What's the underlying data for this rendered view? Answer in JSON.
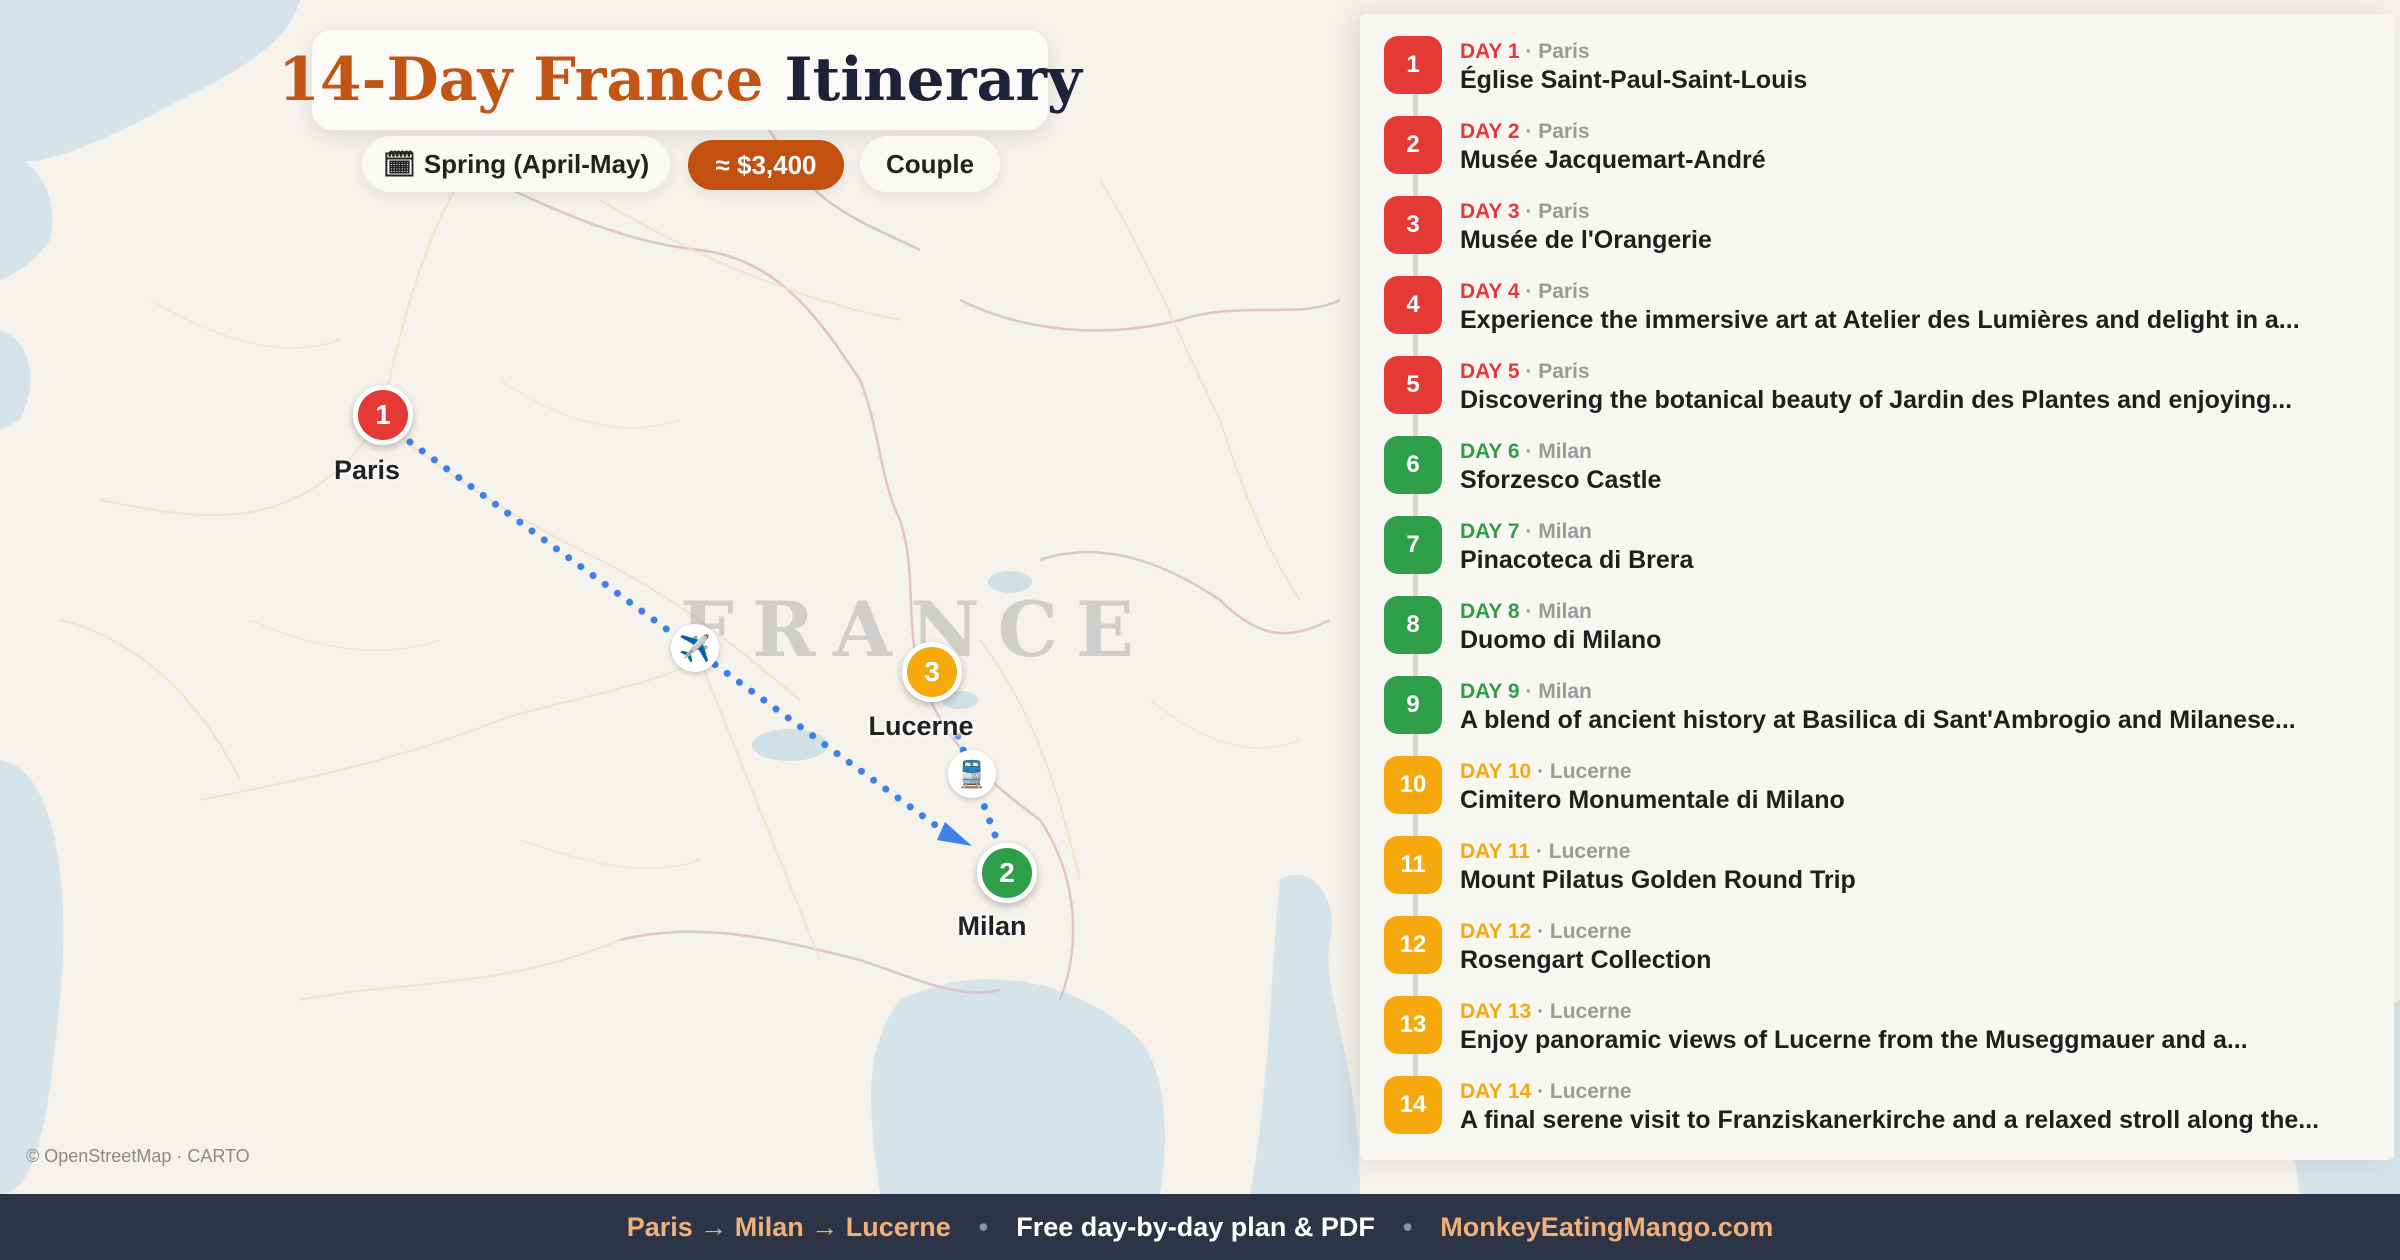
{
  "title": {
    "part1": "14-Day France",
    "part2": "Itinerary"
  },
  "chips": {
    "season": "Spring (April-May)",
    "season_icon": "calendar-icon",
    "budget": "≈ $3,400",
    "travelers": "Couple"
  },
  "map": {
    "country_label": "FRANCE",
    "attribution": "© OpenStreetMap · CARTO",
    "stops": [
      {
        "number": "1",
        "city": "Paris",
        "color": "#e53935"
      },
      {
        "number": "2",
        "city": "Milan",
        "color": "#2e9e49"
      },
      {
        "number": "3",
        "city": "Lucerne",
        "color": "#f5a90d"
      }
    ],
    "legs": [
      {
        "from": "Paris",
        "to": "Milan",
        "mode": "plane",
        "icon": "✈️"
      },
      {
        "from": "Milan",
        "to": "Lucerne",
        "mode": "train",
        "icon": "🚆"
      }
    ]
  },
  "itinerary": [
    {
      "badge": "1",
      "day": "DAY 1",
      "city": "Paris",
      "title": "Église Saint-Paul-Saint-Louis",
      "color": "#e53935"
    },
    {
      "badge": "2",
      "day": "DAY 2",
      "city": "Paris",
      "title": "Musée Jacquemart-André",
      "color": "#e53935"
    },
    {
      "badge": "3",
      "day": "DAY 3",
      "city": "Paris",
      "title": "Musée de l'Orangerie",
      "color": "#e53935"
    },
    {
      "badge": "4",
      "day": "DAY 4",
      "city": "Paris",
      "title": "Experience the immersive art at Atelier des Lumières and delight in a...",
      "color": "#e53935"
    },
    {
      "badge": "5",
      "day": "DAY 5",
      "city": "Paris",
      "title": "Discovering the botanical beauty of Jardin des Plantes and enjoying...",
      "color": "#e53935"
    },
    {
      "badge": "6",
      "day": "DAY 6",
      "city": "Milan",
      "title": "Sforzesco Castle",
      "color": "#2e9e49"
    },
    {
      "badge": "7",
      "day": "DAY 7",
      "city": "Milan",
      "title": "Pinacoteca di Brera",
      "color": "#2e9e49"
    },
    {
      "badge": "8",
      "day": "DAY 8",
      "city": "Milan",
      "title": "Duomo di Milano",
      "color": "#2e9e49"
    },
    {
      "badge": "9",
      "day": "DAY 9",
      "city": "Milan",
      "title": "A blend of ancient history at Basilica di Sant'Ambrogio and Milanese...",
      "color": "#2e9e49"
    },
    {
      "badge": "10",
      "day": "DAY 10",
      "city": "Lucerne",
      "title": "Cimitero Monumentale di Milano",
      "color": "#f5a90d"
    },
    {
      "badge": "11",
      "day": "DAY 11",
      "city": "Lucerne",
      "title": "Mount Pilatus Golden Round Trip",
      "color": "#f5a90d"
    },
    {
      "badge": "12",
      "day": "DAY 12",
      "city": "Lucerne",
      "title": "Rosengart Collection",
      "color": "#f5a90d"
    },
    {
      "badge": "13",
      "day": "DAY 13",
      "city": "Lucerne",
      "title": "Enjoy panoramic views of Lucerne from the Museggmauer and a...",
      "color": "#f5a90d"
    },
    {
      "badge": "14",
      "day": "DAY 14",
      "city": "Lucerne",
      "title": "A final serene visit to Franziskanerkirche and a relaxed stroll along the...",
      "color": "#f5a90d"
    }
  ],
  "footer": {
    "route": "Paris → Milan → Lucerne",
    "plan": "Free day-by-day plan & PDF",
    "site": "MonkeyEatingMango.com",
    "separator": "•"
  }
}
